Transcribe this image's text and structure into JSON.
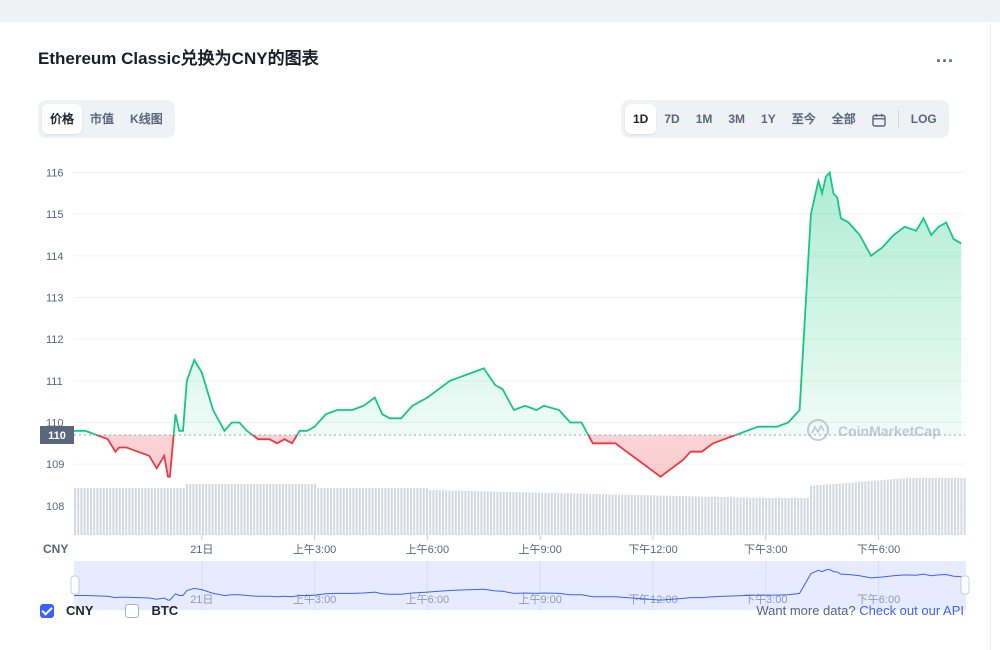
{
  "title": "Ethereum Classic兑换为CNY的图表",
  "more_label": "...",
  "left_tabs": [
    {
      "label": "价格",
      "active": true
    },
    {
      "label": "市值",
      "active": false
    },
    {
      "label": "K线图",
      "active": false
    }
  ],
  "range_tabs": [
    {
      "label": "1D",
      "active": true
    },
    {
      "label": "7D",
      "active": false
    },
    {
      "label": "1M",
      "active": false
    },
    {
      "label": "3M",
      "active": false
    },
    {
      "label": "1Y",
      "active": false
    },
    {
      "label": "至今",
      "active": false
    },
    {
      "label": "全部",
      "active": false
    }
  ],
  "calendar_icon": "calendar-icon",
  "log_label": "LOG",
  "chart_data": {
    "type": "line",
    "y_ticks": [
      116,
      115,
      114,
      113,
      112,
      111,
      110,
      109,
      108
    ],
    "ylim": [
      107.3,
      116.3
    ],
    "x_ticks": [
      "21日",
      "上午3:00",
      "上午6:00",
      "上午9:00",
      "下午12:00",
      "下午3:00",
      "下午6:00"
    ],
    "x_tick_hours": [
      0,
      3,
      6,
      9,
      12,
      15,
      18
    ],
    "xlim_hours": [
      -3.4,
      20.3
    ],
    "x_axis_label": "CNY",
    "reference_value": 109.7,
    "reference_label": "110",
    "watermark": "CoinMarketCap",
    "up_color": "#16c784",
    "down_color": "#ea3943",
    "series": [
      {
        "x": [
          -3.4,
          -3.1,
          -2.8,
          -2.5,
          -2.3,
          -2.2,
          -2.0,
          -1.7,
          -1.4,
          -1.2,
          -1.0,
          -0.9,
          -0.85,
          -0.7,
          -0.6,
          -0.5,
          -0.4,
          -0.2,
          0.0,
          0.3,
          0.6,
          0.8,
          1.0,
          1.2,
          1.5,
          1.8,
          2.0,
          2.2,
          2.4,
          2.6,
          2.8,
          3.0,
          3.3,
          3.6,
          4.0,
          4.3,
          4.6,
          4.8,
          5.0,
          5.3,
          5.6,
          6.0,
          6.3,
          6.6,
          6.9,
          7.2,
          7.5,
          7.8,
          8.0,
          8.3,
          8.6,
          8.9,
          9.1,
          9.5,
          9.8,
          10.1,
          10.4,
          10.7,
          11.0,
          11.3,
          11.6,
          11.9,
          12.2,
          12.5,
          12.8,
          13.0,
          13.3,
          13.6,
          13.9,
          14.2,
          14.5,
          14.8,
          15.1,
          15.3,
          15.6,
          15.9,
          16.2,
          16.4,
          16.5,
          16.6,
          16.7,
          16.8,
          16.9,
          17.0,
          17.2,
          17.5,
          17.8,
          18.1,
          18.4,
          18.7,
          19.0,
          19.2,
          19.4,
          19.6,
          19.8,
          20.0,
          20.2
        ],
        "y": [
          109.8,
          109.8,
          109.7,
          109.6,
          109.3,
          109.4,
          109.4,
          109.3,
          109.2,
          108.9,
          109.2,
          108.7,
          108.7,
          110.2,
          109.8,
          109.8,
          111.0,
          111.5,
          111.2,
          110.3,
          109.8,
          110.0,
          110.0,
          109.8,
          109.6,
          109.6,
          109.5,
          109.6,
          109.5,
          109.8,
          109.8,
          109.9,
          110.2,
          110.3,
          110.3,
          110.4,
          110.6,
          110.2,
          110.1,
          110.1,
          110.4,
          110.6,
          110.8,
          111.0,
          111.1,
          111.2,
          111.3,
          110.9,
          110.8,
          110.3,
          110.4,
          110.3,
          110.4,
          110.3,
          110.0,
          110.0,
          109.5,
          109.5,
          109.5,
          109.3,
          109.1,
          108.9,
          108.7,
          108.9,
          109.1,
          109.3,
          109.3,
          109.5,
          109.6,
          109.7,
          109.8,
          109.9,
          109.9,
          109.9,
          110.0,
          110.3,
          115.0,
          115.8,
          115.5,
          115.9,
          116.0,
          115.5,
          115.4,
          114.9,
          114.8,
          114.5,
          114.0,
          114.2,
          114.5,
          114.7,
          114.6,
          114.9,
          114.5,
          114.7,
          114.8,
          114.4,
          114.3
        ]
      }
    ],
    "navigator_x_ticks": [
      "21日",
      "上午3:00",
      "上午6:00",
      "上午9:00",
      "下午12:00",
      "下午3:00",
      "下午6:00"
    ]
  },
  "footer": {
    "series_toggles": [
      {
        "label": "CNY",
        "checked": true
      },
      {
        "label": "BTC",
        "checked": false
      }
    ],
    "more_data_text": "Want more data?",
    "api_link": "Check out our API"
  }
}
